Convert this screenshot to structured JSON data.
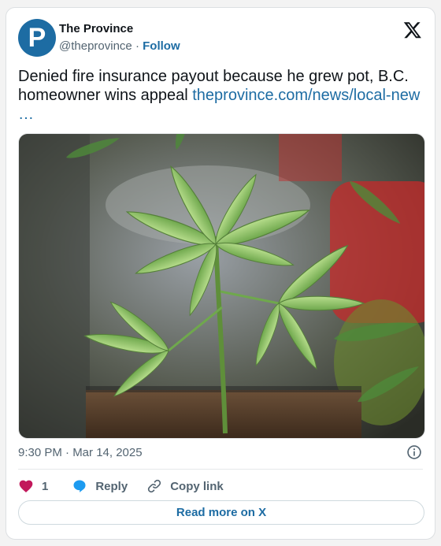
{
  "author": {
    "name": "The Province",
    "handle": "@theprovince",
    "separator": " · ",
    "follow_label": "Follow",
    "avatar_letter": "P",
    "avatar_color": "#1d6ca3"
  },
  "tweet": {
    "text": "Denied fire insurance payout because he grew pot, B.C. homeowner wins appeal ",
    "link_text": "theprovince.com/news/local-new",
    "ellipsis": "…",
    "image_alt": "Cannabis plant seedling in a pot"
  },
  "meta": {
    "timestamp": "9:30 PM · Mar 14, 2025"
  },
  "actions": {
    "like_count": "1",
    "reply_label": "Reply",
    "copy_label": "Copy link"
  },
  "footer": {
    "read_more_label": "Read more on X"
  },
  "colors": {
    "accent": "#1d6ca3",
    "like": "#f91880"
  },
  "icons": [
    "x-logo-icon",
    "info-icon",
    "heart-icon",
    "reply-bubble-icon",
    "link-icon"
  ]
}
